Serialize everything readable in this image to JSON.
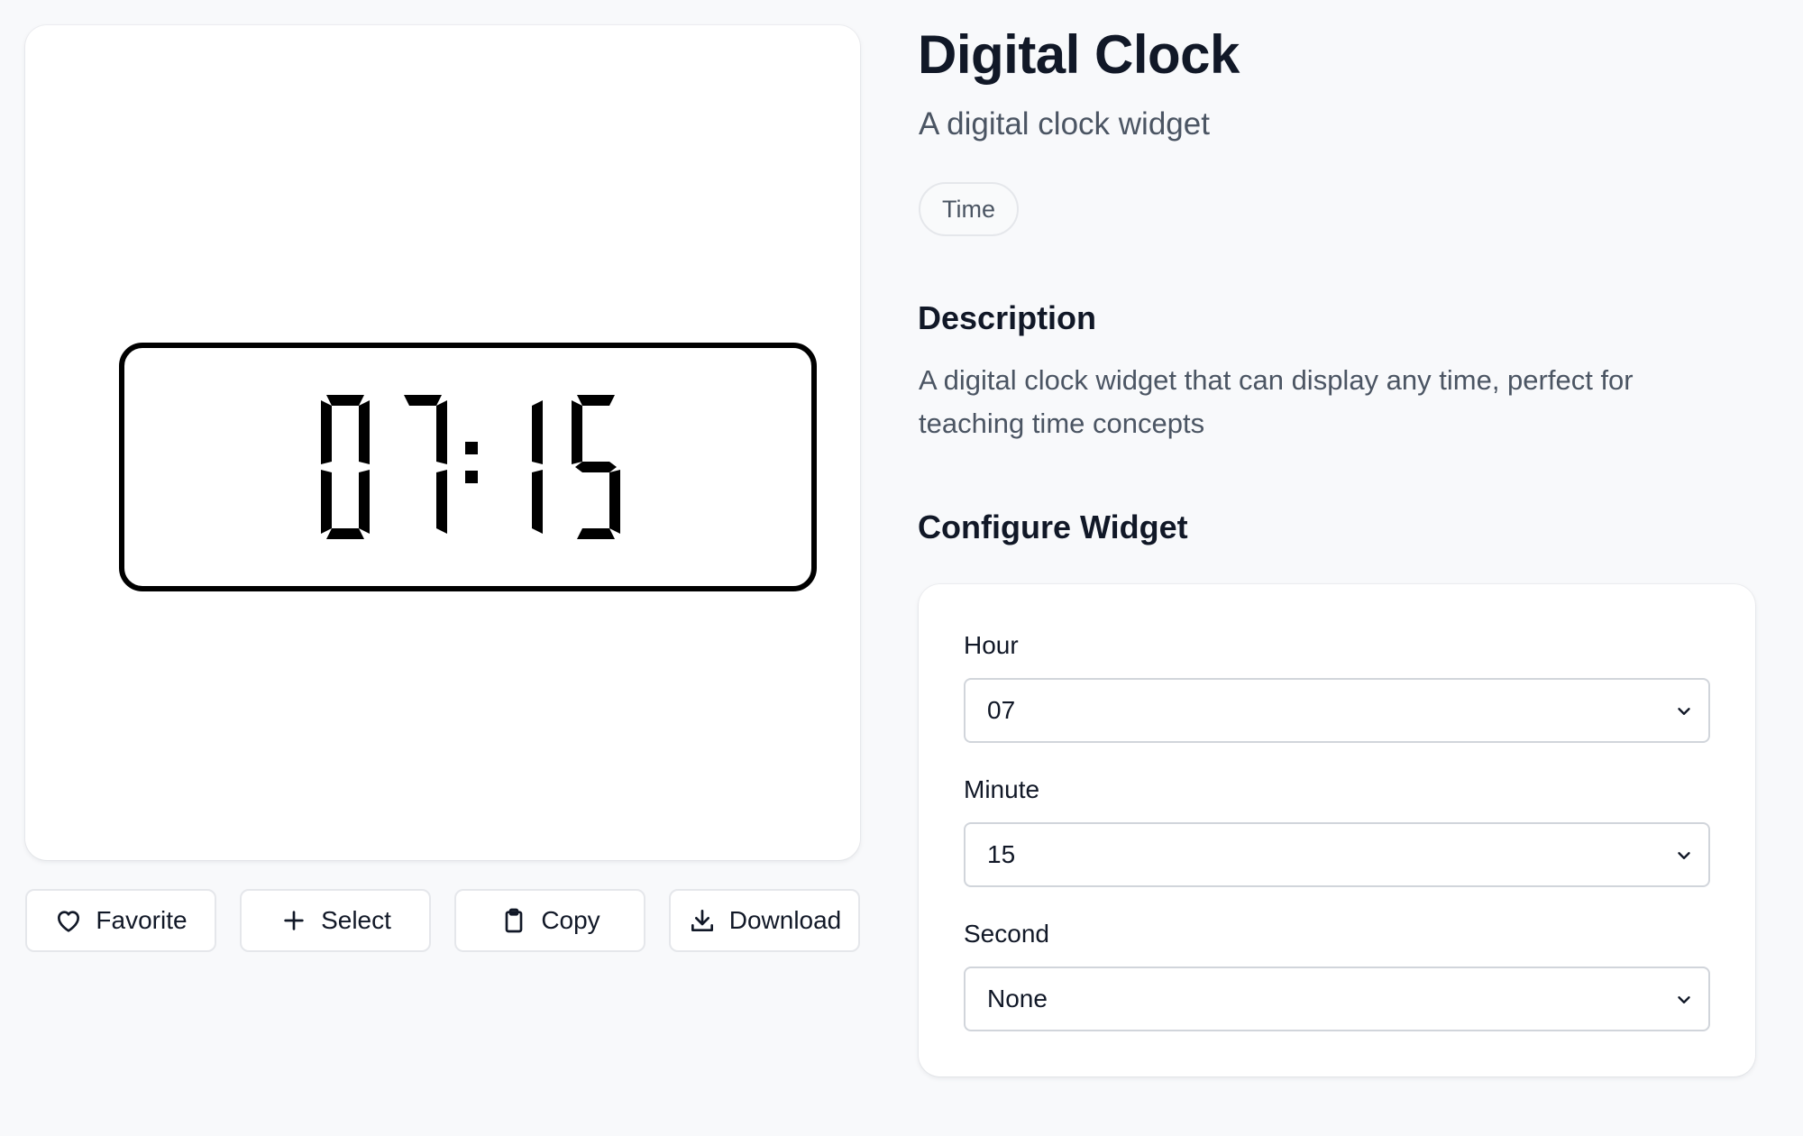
{
  "widget": {
    "title": "Digital Clock",
    "subtitle": "A digital clock widget",
    "tag": "Time",
    "description_heading": "Description",
    "description": "A digital clock widget that can display any time, perfect for teaching time concepts",
    "configure_heading": "Configure Widget"
  },
  "clock": {
    "hours": "07",
    "minutes": "15"
  },
  "actions": {
    "favorite": {
      "label": "Favorite",
      "icon": "heart-icon"
    },
    "select": {
      "label": "Select",
      "icon": "plus-icon"
    },
    "copy": {
      "label": "Copy",
      "icon": "clipboard-icon"
    },
    "download": {
      "label": "Download",
      "icon": "download-icon"
    }
  },
  "config": {
    "hour": {
      "label": "Hour",
      "value": "07"
    },
    "minute": {
      "label": "Minute",
      "value": "15"
    },
    "second": {
      "label": "Second",
      "value": "None"
    }
  }
}
